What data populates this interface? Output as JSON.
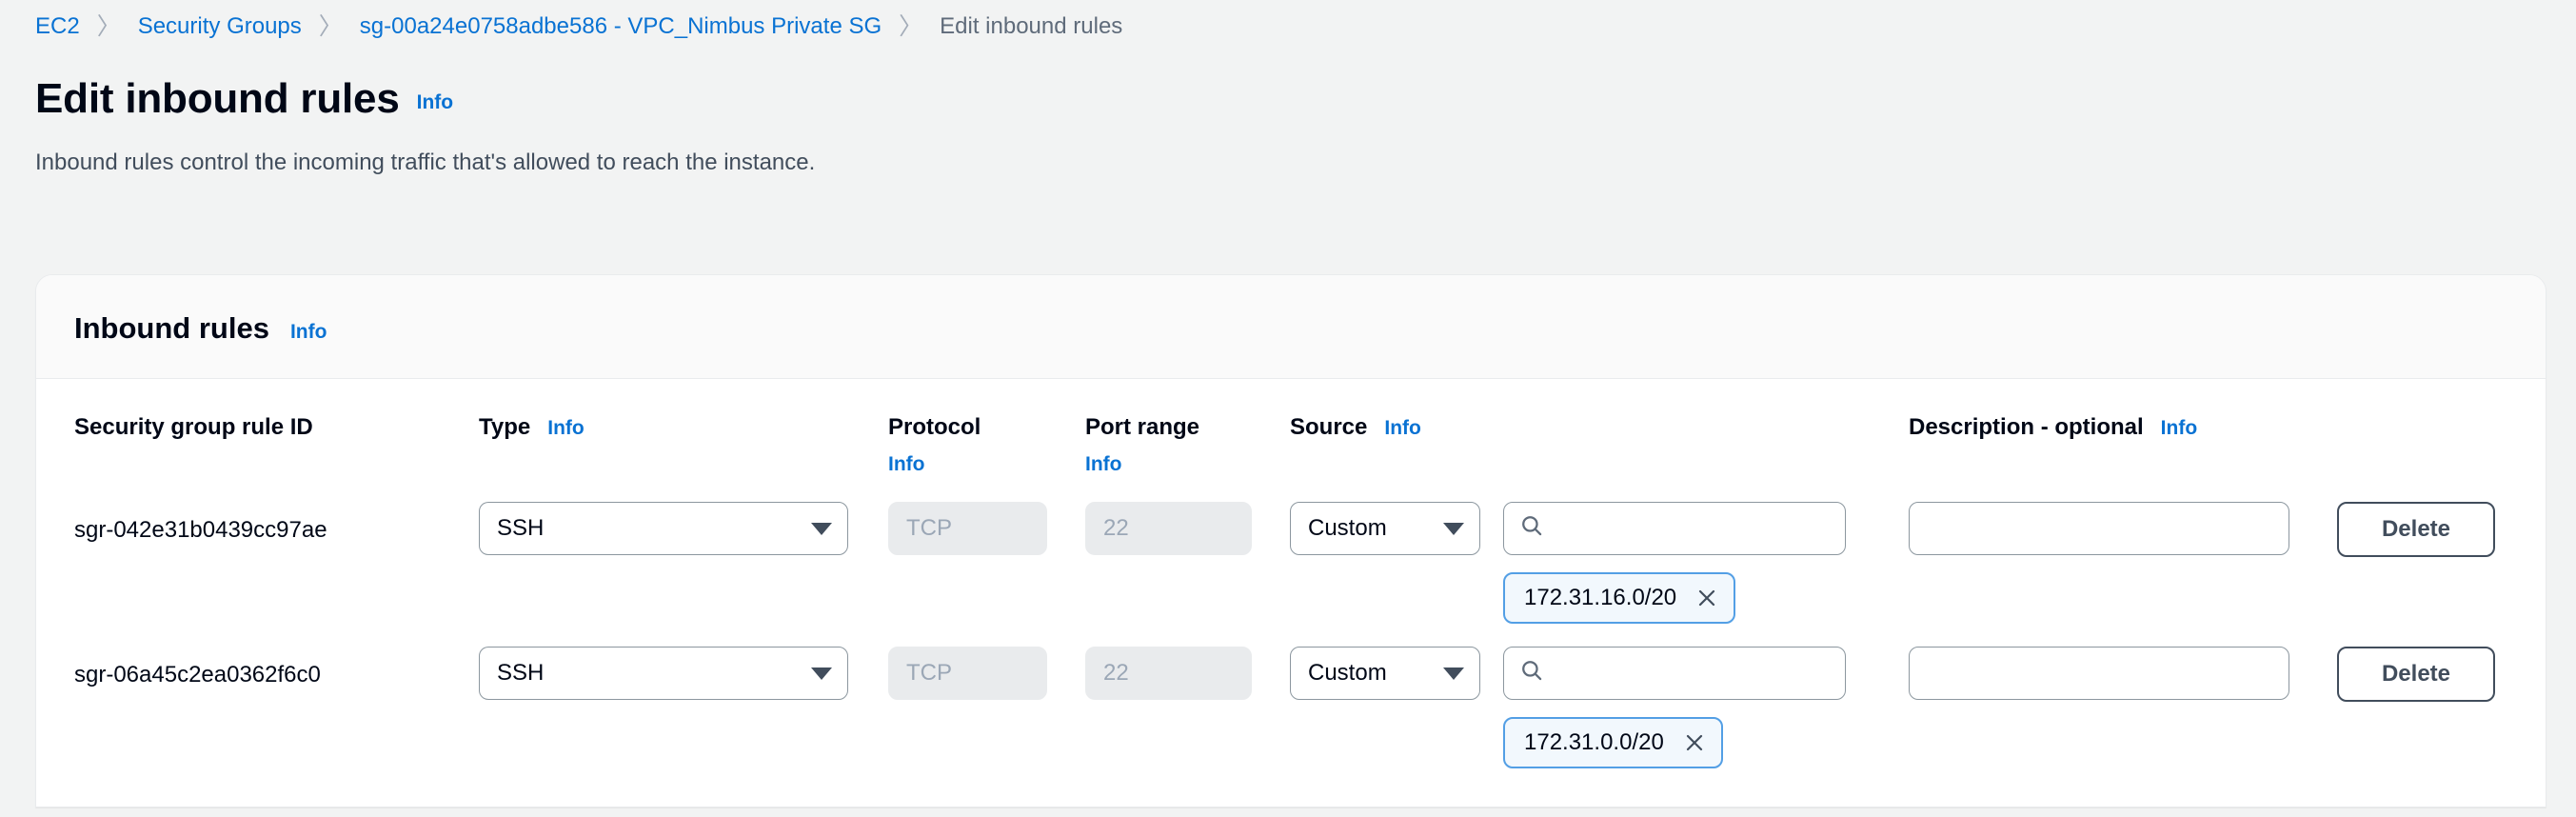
{
  "breadcrumb": {
    "items": [
      {
        "label": "EC2",
        "type": "link"
      },
      {
        "label": "Security Groups",
        "type": "link"
      },
      {
        "label": "sg-00a24e0758adbe586 - VPC_Nimbus Private SG",
        "type": "link"
      },
      {
        "label": "Edit inbound rules",
        "type": "current"
      }
    ],
    "separator": "〉"
  },
  "header": {
    "title": "Edit inbound rules",
    "info_label": "Info",
    "description": "Inbound rules control the incoming traffic that's allowed to reach the instance."
  },
  "panel": {
    "title": "Inbound rules",
    "info_label": "Info"
  },
  "table": {
    "columns": {
      "rule_id": {
        "label": "Security group rule ID",
        "info": null
      },
      "type": {
        "label": "Type",
        "info": "Info"
      },
      "protocol": {
        "label": "Protocol",
        "info": "Info"
      },
      "port_range": {
        "label": "Port range",
        "info": "Info"
      },
      "source": {
        "label": "Source",
        "info": "Info"
      },
      "description": {
        "label": "Description - optional",
        "info": "Info"
      }
    },
    "rows": [
      {
        "rule_id": "sgr-042e31b0439cc97ae",
        "type": "SSH",
        "protocol": "TCP",
        "port_range": "22",
        "source_kind": "Custom",
        "source_search_value": "",
        "source_search_placeholder": "",
        "source_tokens": [
          {
            "label": "172.31.16.0/20",
            "dismiss": "✕"
          }
        ],
        "description_value": "",
        "description_placeholder": "",
        "delete_label": "Delete"
      },
      {
        "rule_id": "sgr-06a45c2ea0362f6c0",
        "type": "SSH",
        "protocol": "TCP",
        "port_range": "22",
        "source_kind": "Custom",
        "source_search_value": "",
        "source_search_placeholder": "",
        "source_tokens": [
          {
            "label": "172.31.0.0/20",
            "dismiss": "✕"
          }
        ],
        "description_value": "",
        "description_placeholder": "",
        "delete_label": "Delete"
      }
    ]
  },
  "icons": {
    "search": "search-icon",
    "caret_down": "chevron-down-icon",
    "dismiss": "close-icon"
  },
  "colors": {
    "link": "#0972d3",
    "page_bg": "#f2f3f3",
    "panel_bg": "#ffffff",
    "panel_header_bg": "#fafafa",
    "border": "#8c979f",
    "disabled_bg": "#e9ebed",
    "token_border": "#539fe5",
    "token_bg": "#f2f8fd",
    "button_border": "#414d5c"
  }
}
